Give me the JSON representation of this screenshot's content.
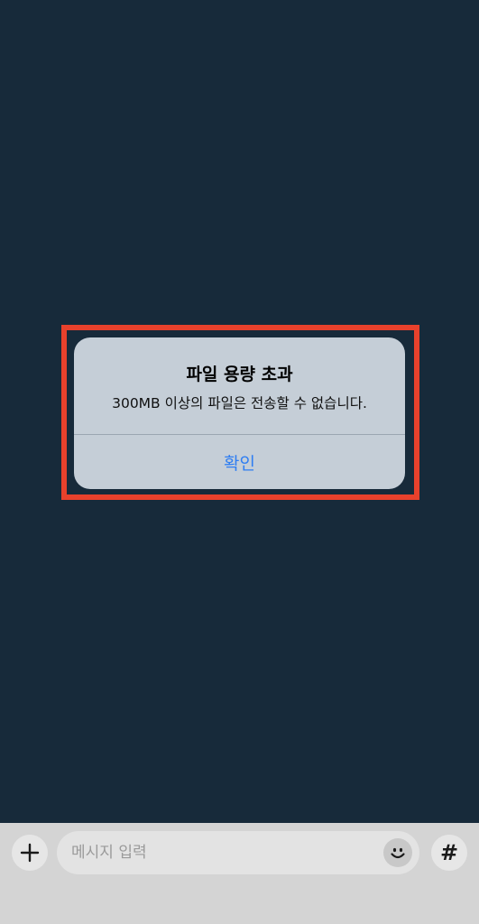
{
  "alert": {
    "title": "파일 용량 초과",
    "message": "300MB 이상의 파일은 전송할 수 없습니다.",
    "confirm_label": "확인"
  },
  "input_bar": {
    "placeholder": "메시지 입력",
    "hash_symbol": "#",
    "icons": {
      "add": "plus-icon",
      "emoji": "emoji-icon",
      "hashtag": "hashtag-icon"
    }
  },
  "colors": {
    "background": "#172a3a",
    "highlight": "#e8412c",
    "alert_bg": "#c5ced7",
    "accent": "#2f7ef2",
    "input_bar_bg": "#d4d4d4"
  }
}
